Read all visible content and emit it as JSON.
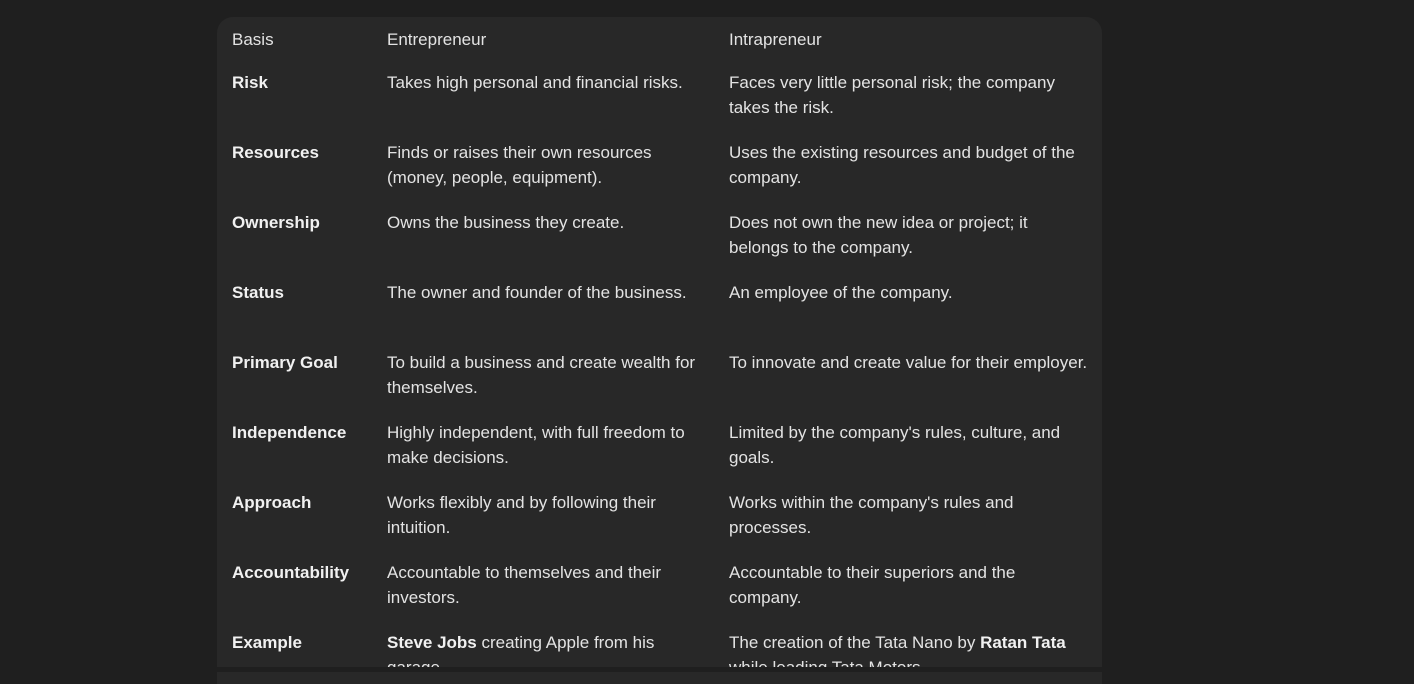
{
  "table": {
    "headers": [
      "Basis",
      "Entrepreneur",
      "Intrapreneur"
    ],
    "rows": [
      {
        "basis": "Risk",
        "entrepreneur": "Takes high personal and financial risks.",
        "intrapreneur": "Faces very little personal risk; the company takes the risk."
      },
      {
        "basis": "Resources",
        "entrepreneur": "Finds or raises their own resources (money, people, equipment).",
        "intrapreneur": "Uses the existing resources and budget of the company."
      },
      {
        "basis": "Ownership",
        "entrepreneur": "Owns the business they create.",
        "intrapreneur": "Does not own the new idea or project; it belongs to the company."
      },
      {
        "basis": "Status",
        "entrepreneur": "The owner and founder of the business.",
        "intrapreneur": "An employee of the company."
      },
      {
        "basis": "Primary Goal",
        "entrepreneur": "To build a business and create wealth for themselves.",
        "intrapreneur": "To innovate and create value for their employer."
      },
      {
        "basis": "Independence",
        "entrepreneur": "Highly independent, with full freedom to make decisions.",
        "intrapreneur": "Limited by the company's rules, culture, and goals."
      },
      {
        "basis": "Approach",
        "entrepreneur": "Works flexibly and by following their intuition.",
        "intrapreneur": "Works within the company's rules and processes."
      },
      {
        "basis": "Accountability",
        "entrepreneur": "Accountable to themselves and their investors.",
        "intrapreneur": "Accountable to their superiors and the company."
      },
      {
        "basis": "Example",
        "entrepreneur_bold": "Steve Jobs",
        "entrepreneur_rest": " creating Apple from his garage.",
        "intrapreneur_pre": "The creation of the Tata Nano by ",
        "intrapreneur_bold": "Ratan Tata",
        "intrapreneur_rest": " while leading Tata Motors."
      }
    ]
  },
  "colors": {
    "page_background": "#1f1f1f",
    "table_background": "#282828",
    "text": "#e3e3e3"
  }
}
